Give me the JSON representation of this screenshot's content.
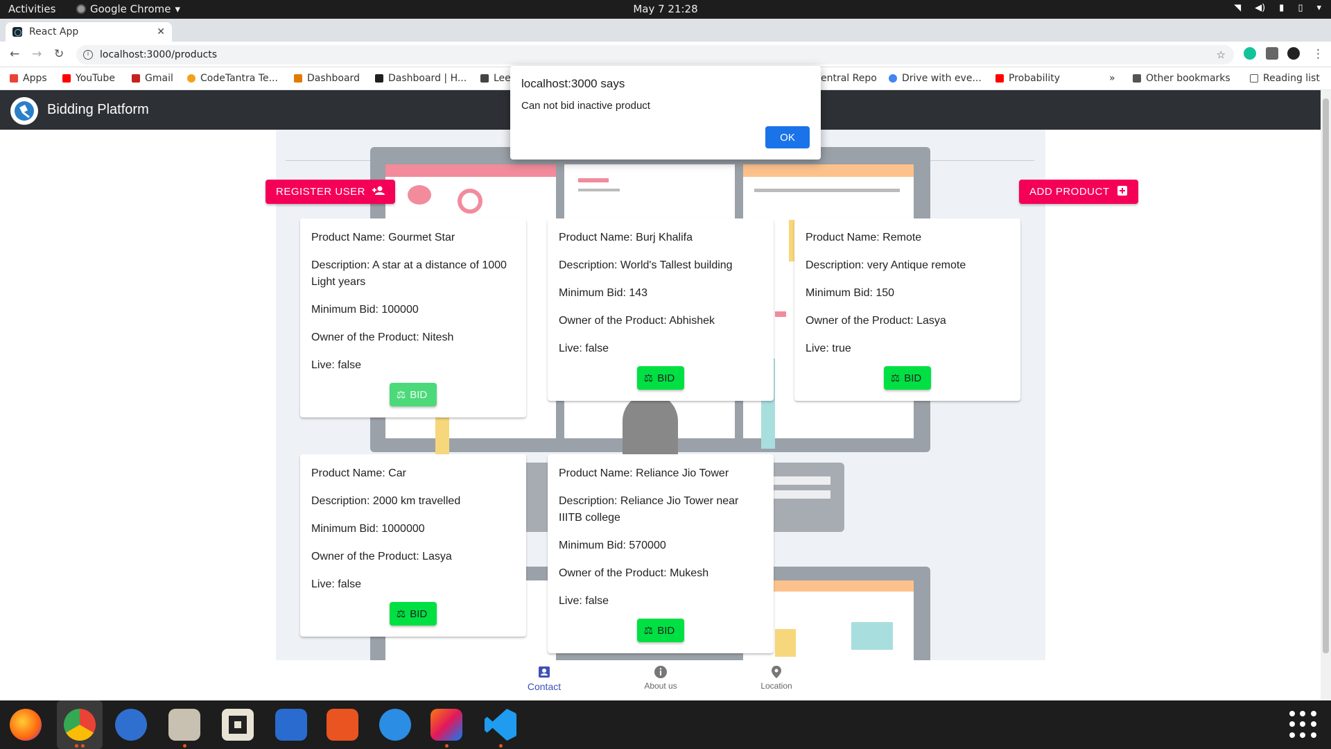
{
  "system_bar": {
    "activities": "Activities",
    "app_name": "Google Chrome",
    "clock": "May 7  21:28"
  },
  "browser": {
    "tab_title": "React App",
    "url": "localhost:3000/products",
    "bookmarks": [
      {
        "label": "Apps",
        "color": "#ea4335"
      },
      {
        "label": "YouTube",
        "color": "#ff0000"
      },
      {
        "label": "Gmail",
        "color": "#c5221f"
      },
      {
        "label": "CodeTantra Te...",
        "color": "#f4a11a"
      },
      {
        "label": "Dashboard",
        "color": "#e07b00"
      },
      {
        "label": "Dashboard | H...",
        "color": "#1f1f1f"
      },
      {
        "label": "Lee",
        "color": "#444444"
      },
      {
        "label": "entral Repo",
        "color": "#888888"
      },
      {
        "label": "Drive with eve...",
        "color": "#4285f4"
      },
      {
        "label": "Probability",
        "color": "#ff0000"
      }
    ],
    "overflow": "»",
    "other_bookmarks": "Other bookmarks",
    "reading_list": "Reading list"
  },
  "app": {
    "title": "Bidding Platform",
    "register_button": "REGISTER USER",
    "add_product_button": "ADD PRODUCT",
    "bid_label": "BID",
    "products": [
      {
        "name": "Product Name: Gourmet Star",
        "description": "Description: A star at a distance of 1000 Light years",
        "min_bid": "Minimum Bid: 100000",
        "owner": "Owner of the Product: Nitesh",
        "live": "Live: false"
      },
      {
        "name": "Product Name: Burj Khalifa",
        "description": "Description: World's Tallest building",
        "min_bid": "Minimum Bid: 143",
        "owner": "Owner of the Product: Abhishek",
        "live": "Live: false"
      },
      {
        "name": "Product Name: Remote",
        "description": "Description: very Antique remote",
        "min_bid": "Minimum Bid: 150",
        "owner": "Owner of the Product: Lasya",
        "live": "Live: true"
      },
      {
        "name": "Product Name: Car",
        "description": "Description: 2000 km travelled",
        "min_bid": "Minimum Bid: 1000000",
        "owner": "Owner of the Product: Lasya",
        "live": "Live: false"
      },
      {
        "name": "Product Name: Reliance Jio Tower",
        "description": "Description: Reliance Jio Tower near IIITB college",
        "min_bid": "Minimum Bid: 570000",
        "owner": "Owner of the Product: Mukesh",
        "live": "Live: false"
      }
    ],
    "bottom_nav": [
      {
        "label": "Contact",
        "active": true
      },
      {
        "label": "About us",
        "active": false
      },
      {
        "label": "Location",
        "active": false
      }
    ]
  },
  "dialog": {
    "title": "localhost:3000 says",
    "message": "Can not bid inactive product",
    "ok": "OK"
  },
  "colors": {
    "appbar": "#2d3136",
    "pink_button": "#f50057",
    "bid_button": "#00e043",
    "dialog_ok": "#1a73e8",
    "nav_active": "#3f51b5"
  }
}
